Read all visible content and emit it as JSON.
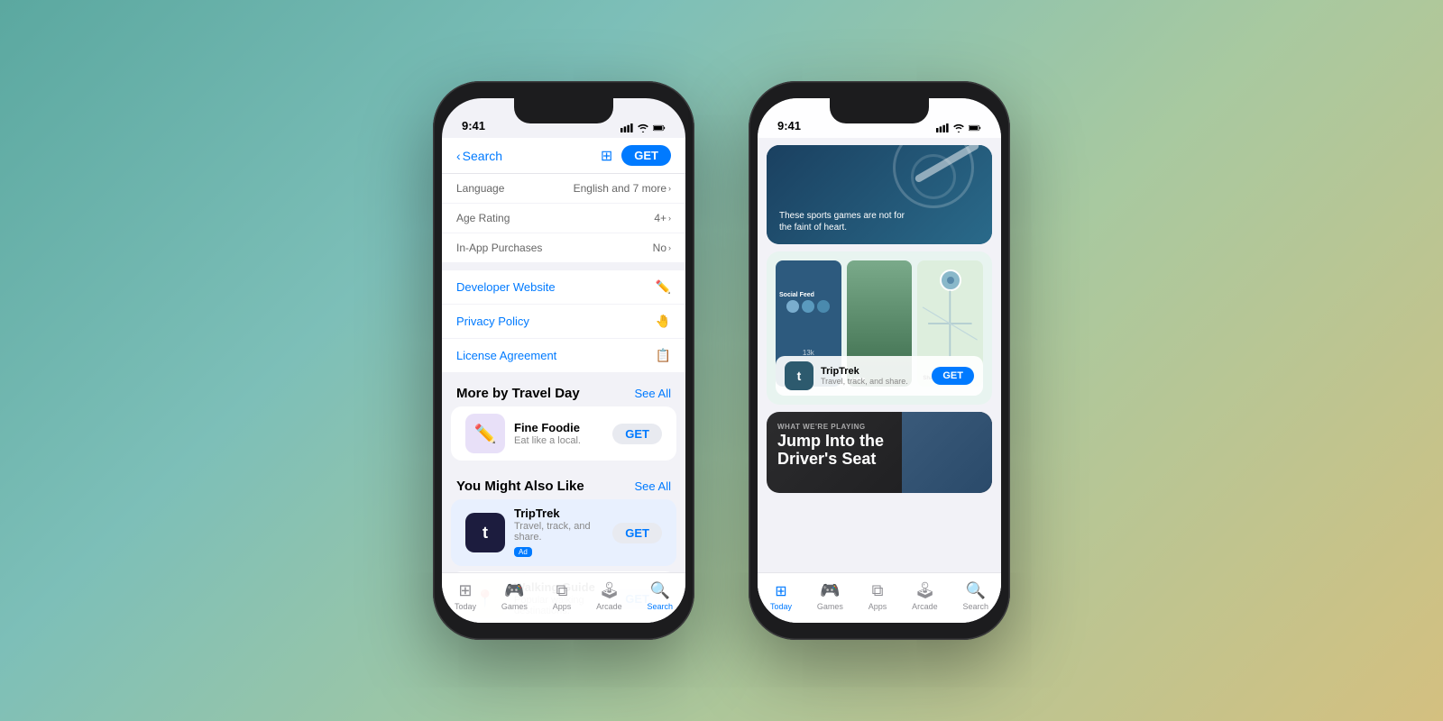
{
  "background": {
    "gradient": "teal to tan"
  },
  "phone1": {
    "status": {
      "time": "9:41",
      "signal": "●●●●",
      "wifi": "wifi",
      "battery": "battery"
    },
    "header": {
      "back_label": "Search",
      "get_label": "GET"
    },
    "info_rows": [
      {
        "label": "Language",
        "value": "English and 7 more ›"
      },
      {
        "label": "Age Rating",
        "value": "4+ ›"
      },
      {
        "label": "In-App Purchases",
        "value": "No ›"
      }
    ],
    "link_rows": [
      {
        "label": "Developer Website",
        "icon": "✏️"
      },
      {
        "label": "Privacy Policy",
        "icon": "🤚"
      },
      {
        "label": "License Agreement",
        "icon": "📋"
      }
    ],
    "more_section": {
      "title": "More by Travel Day",
      "see_all": "See All",
      "apps": [
        {
          "name": "Fine Foodie",
          "desc": "Eat like a local.",
          "icon": "✏️",
          "icon_bg": "pencil",
          "badge": ""
        }
      ]
    },
    "also_like_section": {
      "title": "You Might Also Like",
      "see_all": "See All",
      "apps": [
        {
          "name": "TripTrek",
          "desc": "Travel, track, and share.",
          "icon": "t",
          "icon_bg": "dark",
          "badge": "Ad",
          "highlighted": true
        },
        {
          "name": "Walking Guide",
          "desc": "Popular walking destinations.",
          "icon": "📍",
          "icon_bg": "light",
          "badge": ""
        }
      ]
    },
    "tab_bar": [
      {
        "label": "Today",
        "icon": "⊞",
        "active": false
      },
      {
        "label": "Games",
        "icon": "🎮",
        "active": false
      },
      {
        "label": "Apps",
        "icon": "⧉",
        "active": false
      },
      {
        "label": "Arcade",
        "icon": "🕹",
        "active": false
      },
      {
        "label": "Search",
        "icon": "🔍",
        "active": true
      }
    ]
  },
  "phone2": {
    "status": {
      "time": "9:41",
      "signal": "●●●●",
      "wifi": "wifi",
      "battery": "battery"
    },
    "featured_cards": [
      {
        "type": "sports",
        "subtitle": "These sports games are not for\nthe faint of heart."
      }
    ],
    "app_spotlight": {
      "name": "TripTrek",
      "desc": "Travel, track, and share.",
      "get_label": "GET",
      "screens": [
        "social",
        "profile",
        "map"
      ]
    },
    "playing_card": {
      "label": "WHAT WE'RE PLAYING",
      "title": "Jump Into the\nDriver's Seat"
    },
    "tab_bar": [
      {
        "label": "Today",
        "icon": "⊞",
        "active": true
      },
      {
        "label": "Games",
        "icon": "🎮",
        "active": false
      },
      {
        "label": "Apps",
        "icon": "⧉",
        "active": false
      },
      {
        "label": "Arcade",
        "icon": "🕹",
        "active": false
      },
      {
        "label": "Search",
        "icon": "🔍",
        "active": false
      }
    ]
  }
}
